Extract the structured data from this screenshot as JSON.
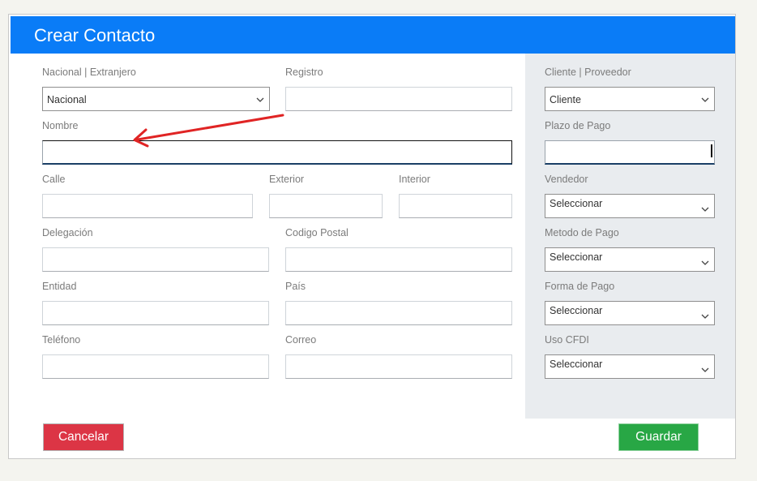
{
  "header": {
    "title": "Crear Contacto"
  },
  "form": {
    "nacional_extranjero": {
      "label": "Nacional | Extranjero",
      "value": "Nacional"
    },
    "registro": {
      "label": "Registro",
      "value": ""
    },
    "nombre": {
      "label": "Nombre",
      "value": ""
    },
    "calle": {
      "label": "Calle",
      "value": ""
    },
    "exterior": {
      "label": "Exterior",
      "value": ""
    },
    "interior": {
      "label": "Interior",
      "value": ""
    },
    "delegacion": {
      "label": "Delegación",
      "value": ""
    },
    "codigo_postal": {
      "label": "Codigo Postal",
      "value": ""
    },
    "entidad": {
      "label": "Entidad",
      "value": ""
    },
    "pais": {
      "label": "País",
      "value": ""
    },
    "telefono": {
      "label": "Teléfono",
      "value": ""
    },
    "correo": {
      "label": "Correo",
      "value": ""
    }
  },
  "side": {
    "cliente_proveedor": {
      "label": "Cliente | Proveedor",
      "value": "Cliente"
    },
    "plazo_pago": {
      "label": "Plazo de Pago",
      "value": ""
    },
    "vendedor": {
      "label": "Vendedor",
      "value": "Seleccionar"
    },
    "metodo_pago": {
      "label": "Metodo de Pago",
      "value": "Seleccionar"
    },
    "forma_pago": {
      "label": "Forma de Pago",
      "value": "Seleccionar"
    },
    "uso_cfdi": {
      "label": "Uso CFDI",
      "value": "Seleccionar"
    }
  },
  "buttons": {
    "cancel": "Cancelar",
    "save": "Guardar"
  },
  "colors": {
    "header": "#0a7cf7",
    "cancel": "#dc3545",
    "save": "#28a745",
    "side_panel": "#e9ecef",
    "annotation_arrow": "#e02424"
  }
}
